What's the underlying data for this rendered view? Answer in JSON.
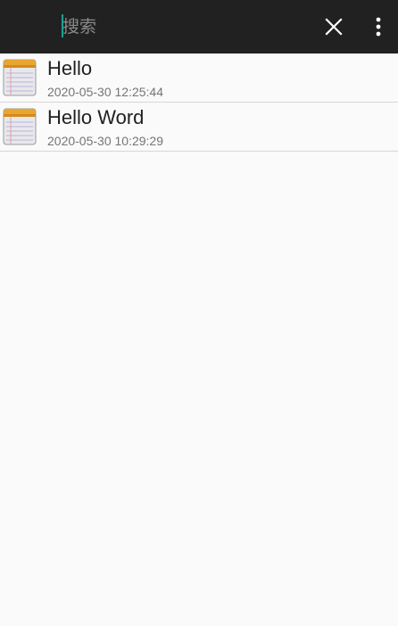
{
  "search": {
    "placeholder": "搜索",
    "value": ""
  },
  "toolbar": {
    "close_icon": "close-icon",
    "more_icon": "more-vertical-icon",
    "background": "#212121",
    "cursor_color": "#1e9e96"
  },
  "notes": [
    {
      "title": "Hello",
      "time": "2020-05-30 12:25:44",
      "icon": "notepad-icon"
    },
    {
      "title": "Hello Word",
      "time": "2020-05-30 10:29:29",
      "icon": "notepad-icon"
    }
  ]
}
